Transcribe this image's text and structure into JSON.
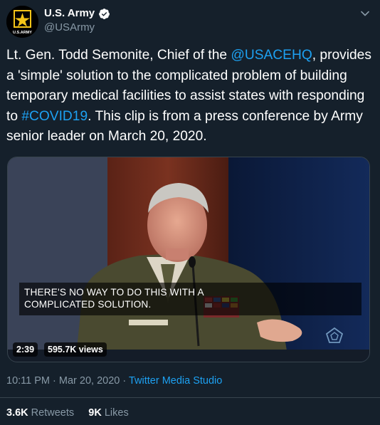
{
  "account": {
    "display_name": "U.S. Army",
    "handle": "@USArmy",
    "avatar_text": "U.S.ARMY",
    "verified_icon": "verified-badge-icon"
  },
  "tweet": {
    "text_1": "Lt. Gen. Todd Semonite, Chief of the ",
    "mention": "@USACEHQ",
    "text_2": ", provides a 'simple' solution to the complicated problem of building temporary medical facilities to assist states with responding to ",
    "hashtag": "#COVID19",
    "text_3": ". This clip is from a press conference by Army senior leader on March 20, 2020."
  },
  "video": {
    "caption_line1": "THERE'S NO WAY TO DO THIS WITH A",
    "caption_line2": "COMPLICATED SOLUTION.",
    "duration": "2:39",
    "views": "595.7K views"
  },
  "meta": {
    "time": "10:11 PM",
    "separator": " · ",
    "date": "Mar 20, 2020",
    "source": "Twitter Media Studio"
  },
  "stats": {
    "retweets_count": "3.6K",
    "retweets_label": "Retweets",
    "likes_count": "9K",
    "likes_label": "Likes"
  },
  "colors": {
    "background": "#15202b",
    "link": "#1da1f2",
    "secondary_text": "#8899a6",
    "divider": "#38444d"
  }
}
